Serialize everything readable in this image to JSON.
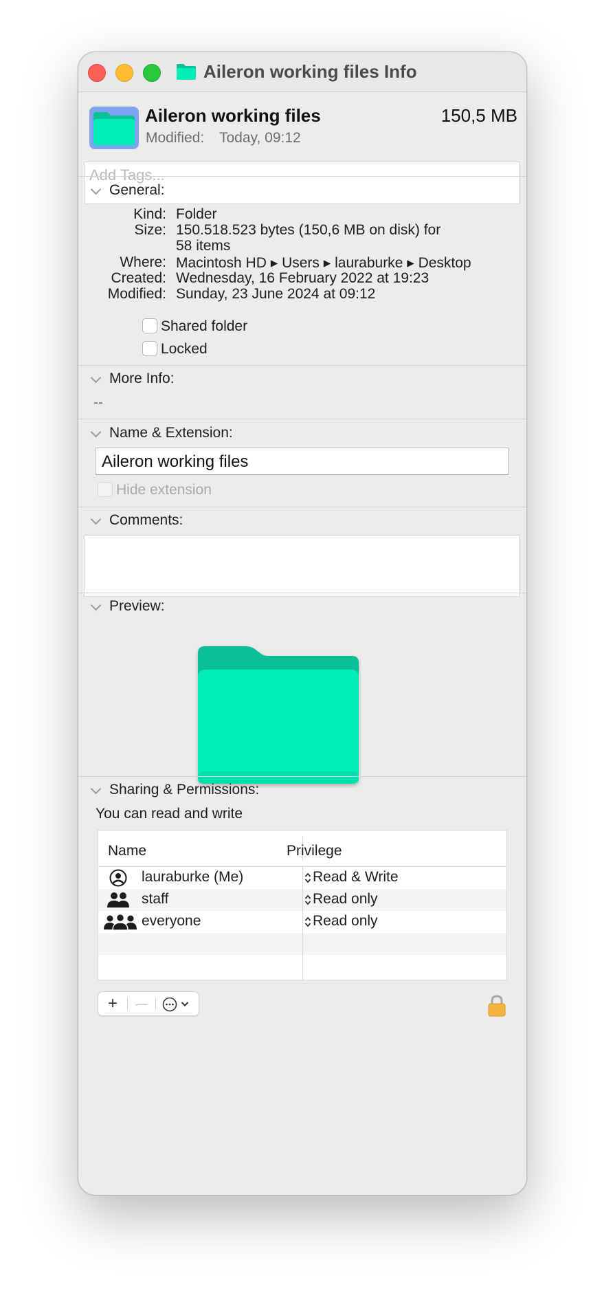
{
  "window": {
    "title": "Aileron working files Info"
  },
  "header": {
    "name": "Aileron working files",
    "size": "150,5 MB",
    "modified_label": "Modified:",
    "modified_value": "Today, 09:12"
  },
  "tags": {
    "placeholder": "Add Tags..."
  },
  "general": {
    "title": "General:",
    "kind_label": "Kind:",
    "kind_value": "Folder",
    "size_label": "Size:",
    "size_value_line1": "150.518.523 bytes (150,6 MB on disk) for",
    "size_value_line2": "58 items",
    "where_label": "Where:",
    "where_value": "Macintosh HD ▸ Users ▸ lauraburke ▸ Desktop",
    "created_label": "Created:",
    "created_value": "Wednesday, 16 February 2022 at 19:23",
    "modified_label": "Modified:",
    "modified_value": "Sunday, 23 June 2024 at 09:12",
    "shared_folder_label": "Shared folder",
    "locked_label": "Locked"
  },
  "more_info": {
    "title": "More Info:",
    "value": "--"
  },
  "name_extension": {
    "title": "Name & Extension:",
    "value": "Aileron working files",
    "hide_extension_label": "Hide extension"
  },
  "comments": {
    "title": "Comments:"
  },
  "preview": {
    "title": "Preview:"
  },
  "sharing": {
    "title": "Sharing & Permissions:",
    "summary": "You can read and write",
    "col_name": "Name",
    "col_privilege": "Privilege",
    "rows": [
      {
        "name": "lauraburke (Me)",
        "privilege": "Read & Write",
        "icon": "user-circle-icon"
      },
      {
        "name": "staff",
        "privilege": "Read only",
        "icon": "group-icon"
      },
      {
        "name": "everyone",
        "privilege": "Read only",
        "icon": "everyone-icon"
      }
    ],
    "add_label": "+",
    "remove_label": "—"
  },
  "colors": {
    "folder_accent": "#00efb8",
    "folder_tab": "#0bbf96",
    "selection_blue": "#7ea6f0"
  }
}
